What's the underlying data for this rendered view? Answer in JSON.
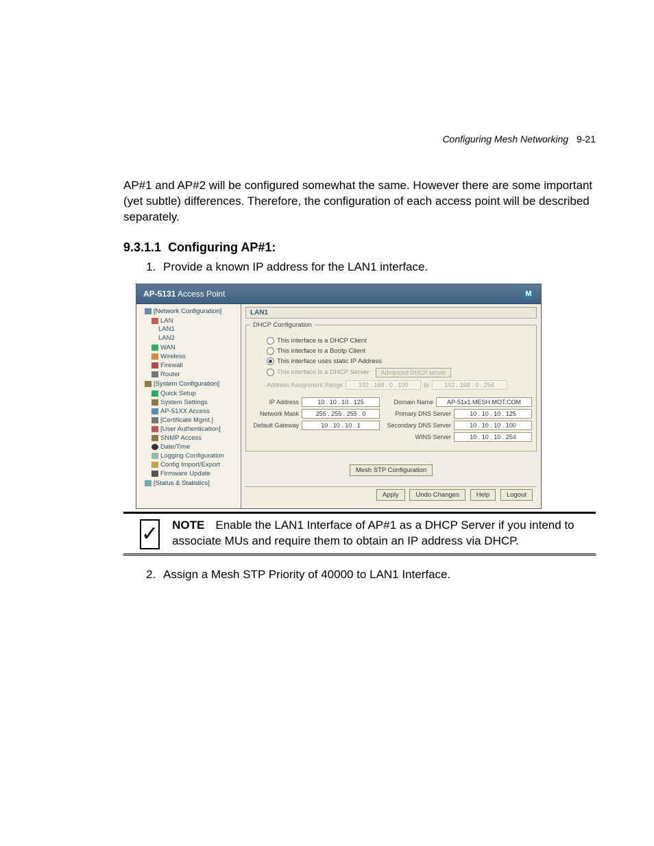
{
  "header": {
    "section": "Configuring Mesh Networking",
    "page": "9-21"
  },
  "intro": "AP#1 and AP#2 will be configured somewhat the same. However there are some important (yet subtle) differences. Therefore, the configuration of each access point will be described separately.",
  "section_num": "9.3.1.1",
  "section_title": "Configuring AP#1:",
  "step1": "Provide a known IP address for the LAN1 interface.",
  "step2": "Assign a Mesh STP Priority of 40000 to LAN1 Interface.",
  "shot": {
    "title_prefix": "AP-5131",
    "title_suffix": "Access Point",
    "tree": {
      "n0": "[Network Configuration]",
      "lan": "LAN",
      "lan1": "LAN1",
      "lan2": "LAN2",
      "wan": "WAN",
      "wireless": "Wireless",
      "firewall": "Firewall",
      "router": "Router",
      "syscfg": "[System Configuration]",
      "quick": "Quick Setup",
      "sysset": "System Settings",
      "apacc": "AP-51XX Access",
      "cert": "[Certificate Mgmt.]",
      "userauth": "[User Authentication]",
      "snmp": "SNMP Access",
      "datetime": "Date/Time",
      "logging": "Logging Configuration",
      "cfgie": "Config Import/Export",
      "fw": "Firmware Update",
      "status": "[Status & Statistics]"
    },
    "lan_head": "LAN1",
    "dhcp_legend": "DHCP Configuration",
    "radios": {
      "r1": "This interface is a DHCP Client",
      "r2": "This interface is a Bootp Client",
      "r3": "This interface uses static IP Address",
      "r4": "This interface is a DHCP Server",
      "adv_btn": "Advanced DHCP server"
    },
    "range": {
      "label": "Address Assignment Range",
      "from": "192 . 168 .  0  . 100",
      "to_lbl": "to",
      "to": "192 . 168 .  0  . 254"
    },
    "left": {
      "ip_lbl": "IP Address",
      "ip": "10 . 10 . 10 . 125",
      "mask_lbl": "Network Mask",
      "mask": "255 . 255 . 255 .  0",
      "gw_lbl": "Default Gateway",
      "gw": "10 . 10 . 10 .  1"
    },
    "right": {
      "dom_lbl": "Domain Name",
      "dom": "AP-51x1.MESH.MOT.COM",
      "pdns_lbl": "Primary DNS Server",
      "pdns": "10 . 10 . 10 . 125",
      "sdns_lbl": "Secondary DNS Server",
      "sdns": "10 . 10 . 10 . 100",
      "wins_lbl": "WINS Server",
      "wins": "10 . 10 . 10 . 254"
    },
    "mesh_btn": "Mesh STP Configuration",
    "bottom": {
      "apply": "Apply",
      "undo": "Undo Changes",
      "help": "Help",
      "logout": "Logout"
    }
  },
  "note": {
    "label": "NOTE",
    "text": "Enable the LAN1 Interface of AP#1 as a DHCP Server if you intend to associate MUs and require them to obtain an IP address via DHCP."
  }
}
